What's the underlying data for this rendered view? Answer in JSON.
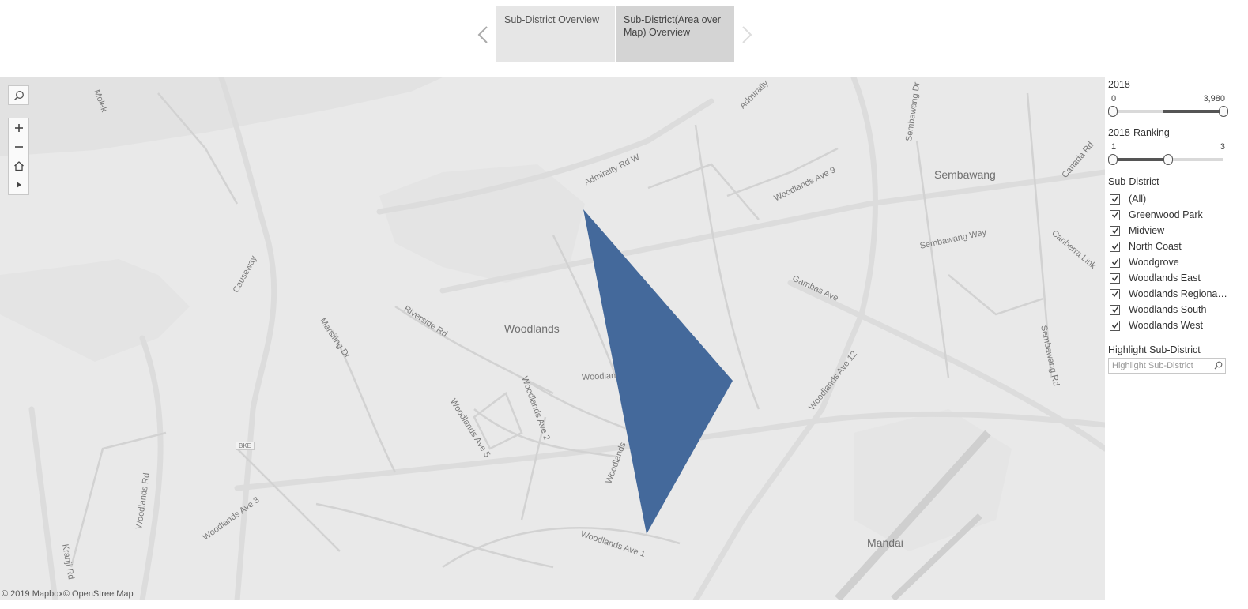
{
  "story": {
    "points": [
      {
        "label": "Sub-District Overview"
      },
      {
        "label": "Sub-District(Area over Map) Overview"
      }
    ]
  },
  "map": {
    "attribution": "© 2019 Mapbox© OpenStreetMap",
    "places": [
      "Woodlands",
      "Sembawang",
      "Mandai"
    ],
    "roads": [
      "Admiralty Rd W",
      "Woodlands Ave 9",
      "Sembawang Way",
      "Gambas Ave",
      "Riverside Rd",
      "Marsiling Dr",
      "Causeway",
      "Woodlands Ave 12",
      "Woodlands Ave 2",
      "Woodlands Ave 5",
      "Woodlands Ave 3",
      "Woodlands Ave 1",
      "Woodlands Rd",
      "Kranji Rd",
      "Sembawang Dr",
      "Canada Rd",
      "Canberra Link",
      "Sembawang Rd",
      "Admiralty",
      "Molek",
      "Woodlan",
      "Woodlands",
      "BKE"
    ],
    "shape_color": "#44699b",
    "background_color": "#e9e9e9",
    "road_color": "#d8d8d8"
  },
  "panel": {
    "filter_2018": {
      "title": "2018",
      "min": "0",
      "max": "3,980",
      "low": 0,
      "high": 1,
      "fill_start": 0.45
    },
    "filter_ranking": {
      "title": "2018-Ranking",
      "min": "1",
      "max": "3",
      "low": 0,
      "high": 0.5
    },
    "sub_district": {
      "title": "Sub-District",
      "items": [
        "(All)",
        "Greenwood Park",
        "Midview",
        "North Coast",
        "Woodgrove",
        "Woodlands East",
        "Woodlands Regional...",
        "Woodlands South",
        "Woodlands West"
      ]
    },
    "highlight": {
      "title": "Highlight Sub-District",
      "placeholder": "Highlight Sub-District"
    }
  }
}
